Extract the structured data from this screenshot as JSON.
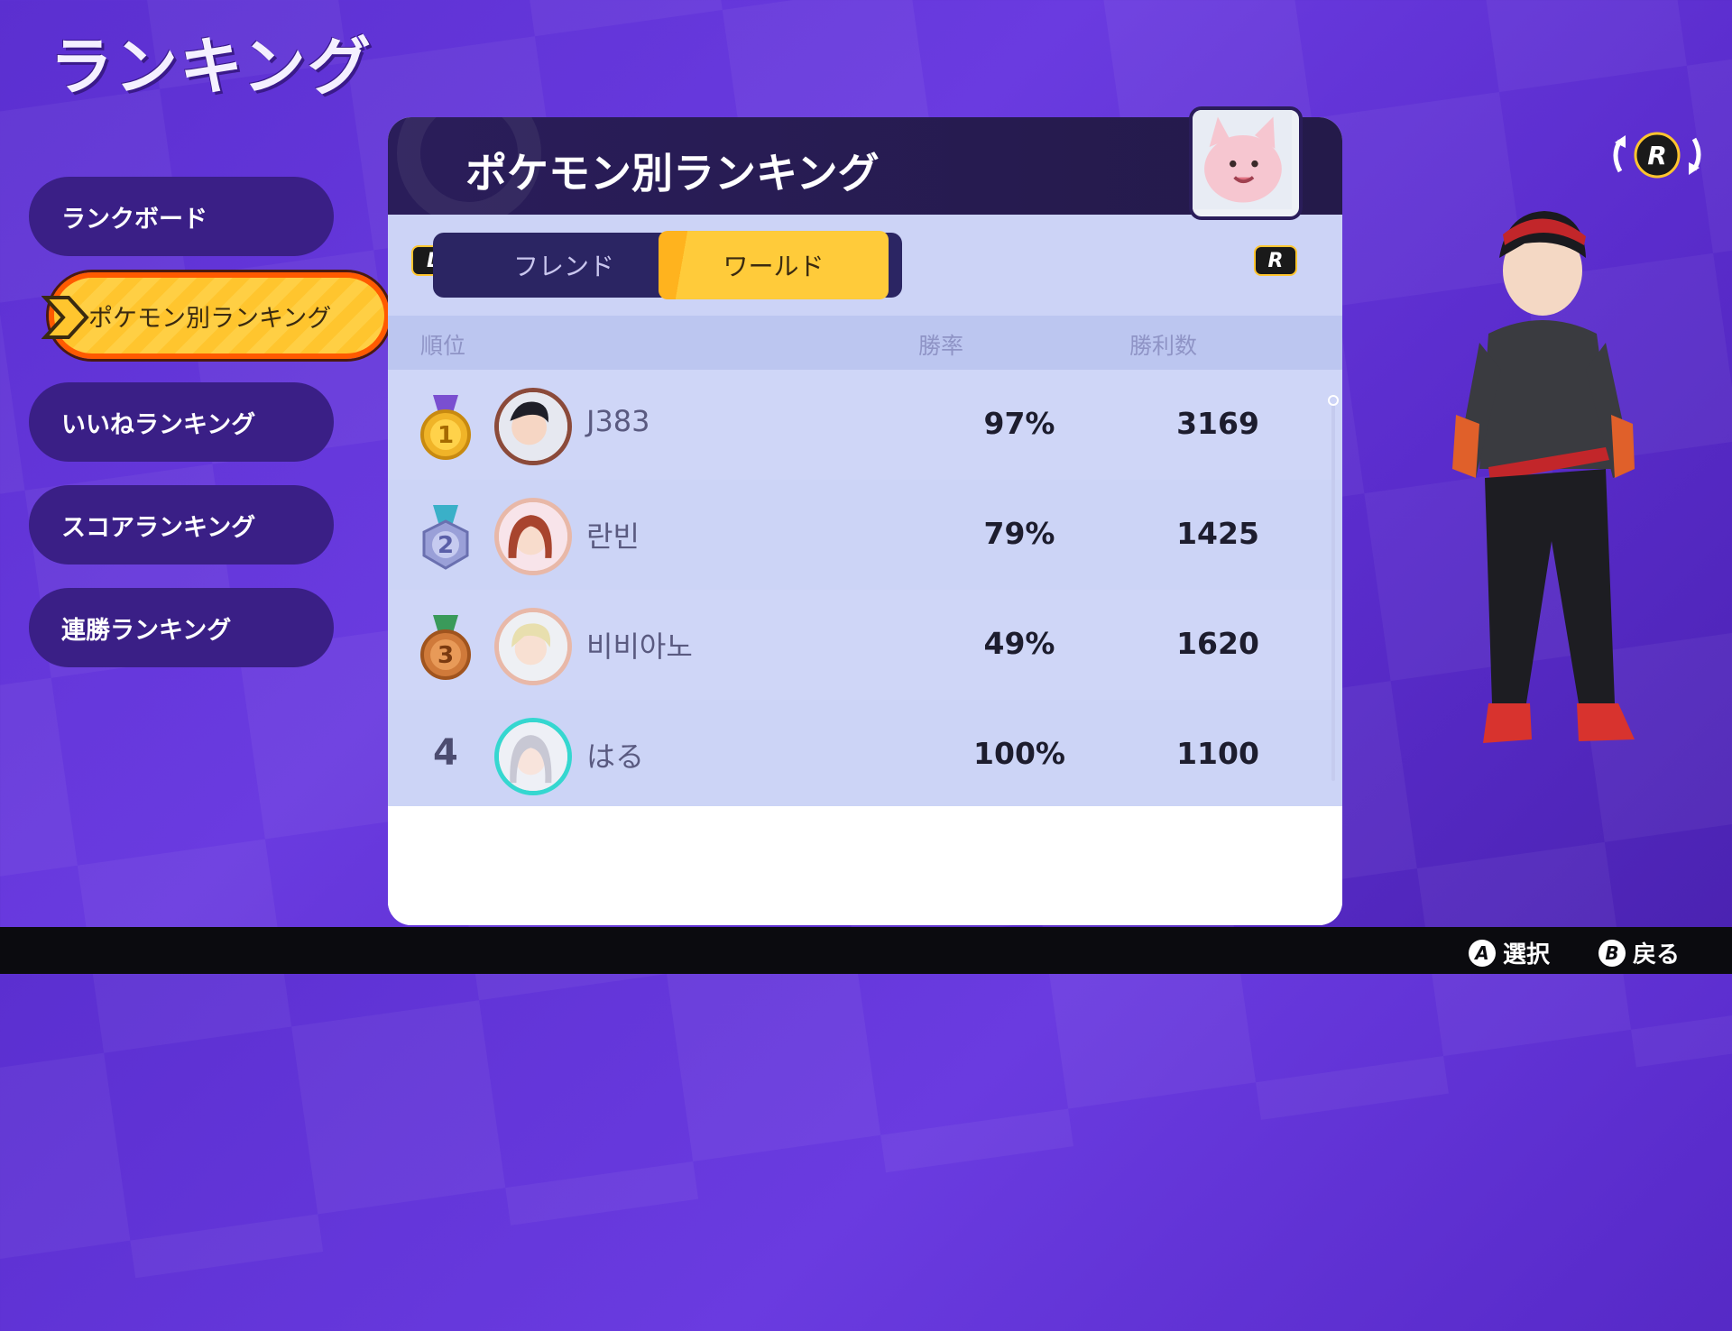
{
  "page": {
    "title": "ランキング"
  },
  "menu": {
    "items": [
      {
        "label": "ランクボード"
      },
      {
        "label": "ポケモン別ランキング",
        "active": true
      },
      {
        "label": "いいねランキング"
      },
      {
        "label": "スコアランキング"
      },
      {
        "label": "連勝ランキング"
      }
    ]
  },
  "panel": {
    "title": "ポケモン別ランキング",
    "tabs": {
      "friend": "フレンド",
      "world": "ワールド",
      "active": "world",
      "left_button": "L",
      "right_button": "R"
    },
    "columns": {
      "rank": "順位",
      "rate": "勝率",
      "wins": "勝利数"
    },
    "rows": [
      {
        "rank": "1",
        "name": "J383",
        "rate": "97%",
        "wins": "3169",
        "medal": "gold"
      },
      {
        "rank": "2",
        "name": "란빈",
        "rate": "79%",
        "wins": "1425",
        "medal": "silver"
      },
      {
        "rank": "3",
        "name": "비비아노",
        "rate": "49%",
        "wins": "1620",
        "medal": "bronze"
      },
      {
        "rank": "4",
        "name": "はる",
        "rate": "100%",
        "wins": "1100",
        "medal": null
      }
    ]
  },
  "right": {
    "rotate_button": "R"
  },
  "footer": {
    "select": {
      "button": "A",
      "label": "選択"
    },
    "back": {
      "button": "B",
      "label": "戻る"
    }
  },
  "colors": {
    "accent": "#ffc52e",
    "menu_bg": "#3a1f86",
    "active_border": "#ff5a00"
  }
}
